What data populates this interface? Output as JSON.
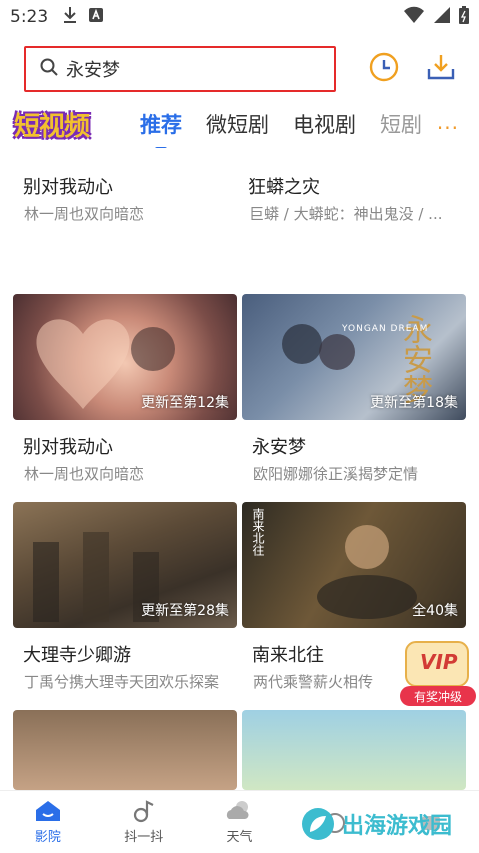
{
  "status_bar": {
    "time": "5:23"
  },
  "search": {
    "query": "永安梦"
  },
  "tabs": {
    "logo": "短视频",
    "items": [
      "推荐",
      "微短剧",
      "电视剧",
      "短剧"
    ],
    "more": "···"
  },
  "row0": [
    {
      "title": "别对我动心",
      "sub": "林一周也双向暗恋"
    },
    {
      "title": "狂蟒之灾",
      "sub": "巨蟒 / 大蟒蛇：神出鬼没 / ..."
    }
  ],
  "row1": [
    {
      "title": "别对我动心",
      "sub": "林一周也双向暗恋",
      "badge": "更新至第12集"
    },
    {
      "title": "永安梦",
      "sub": "欧阳娜娜徐正溪揭梦定情",
      "badge": "更新至第18集",
      "poster_text_cn": "永安梦",
      "poster_text_en": "YONGAN DREAM"
    }
  ],
  "row2": [
    {
      "title": "大理寺少卿游",
      "sub": "丁禹兮携大理寺天团欢乐探案",
      "badge": "更新至第28集"
    },
    {
      "title": "南来北往",
      "sub": "两代乘警薪火相传",
      "badge": "全40集",
      "poster_text": "南来北往"
    }
  ],
  "vip": {
    "label": "VIP",
    "sub": "有奖冲级"
  },
  "bottom_nav": [
    {
      "label": "影院",
      "icon": "home-icon"
    },
    {
      "label": "抖一抖",
      "icon": "music-note-icon"
    },
    {
      "label": "天气",
      "icon": "weather-icon"
    },
    {
      "label": "",
      "icon": "alarm-icon"
    },
    {
      "label": "",
      "icon": "more-icon"
    }
  ],
  "watermark": "出海游戏园",
  "colors": {
    "accent": "#2a6ee8",
    "highlight_box": "#e52a2a",
    "more": "#f09a2b"
  }
}
